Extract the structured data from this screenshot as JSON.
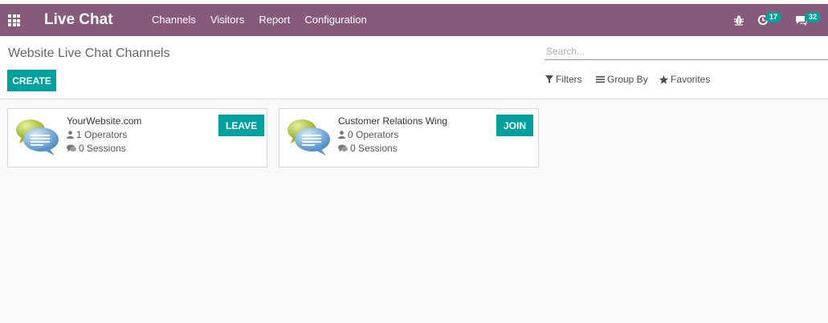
{
  "colors": {
    "topbar": "#875a7b",
    "primary": "#00a09d",
    "background": "#f9f9f9"
  },
  "topbar": {
    "app_title": "Live Chat",
    "menu": [
      "Channels",
      "Visitors",
      "Report",
      "Configuration"
    ],
    "activity_badge": "17",
    "messages_badge": "32",
    "icons": [
      "apps-grid-icon",
      "bug-icon",
      "clock-icon",
      "chat-icon"
    ]
  },
  "control": {
    "title": "Website Live Chat Channels",
    "create_label": "CREATE",
    "search_placeholder": "Search...",
    "filters_label": "Filters",
    "groupby_label": "Group By",
    "favorites_label": "Favorites"
  },
  "channels": [
    {
      "name": "YourWebsite.com",
      "operators": "1 Operators",
      "sessions": "0 Sessions",
      "action": "LEAVE"
    },
    {
      "name": "Customer Relations Wing",
      "operators": "0 Operators",
      "sessions": "0 Sessions",
      "action": "JOIN"
    }
  ]
}
